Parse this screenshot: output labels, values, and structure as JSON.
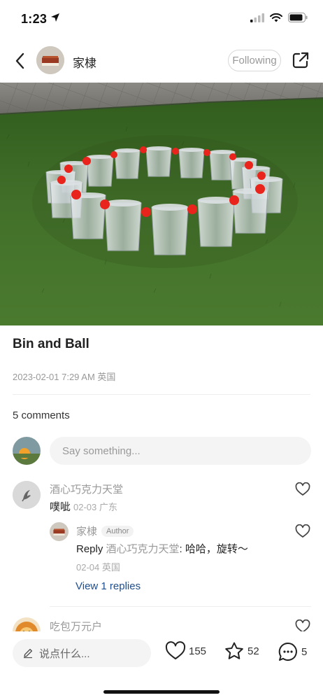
{
  "status_bar": {
    "time": "1:23"
  },
  "nav": {
    "name": "家棣",
    "follow_label": "Following"
  },
  "post": {
    "title": "Bin and Ball",
    "meta": "2023-02-01 7:29 AM 英国"
  },
  "comments_section": {
    "count_label": "5 comments",
    "input_placeholder": "Say something..."
  },
  "comments": [
    {
      "name": "酒心巧克力天堂",
      "text": "噗呲",
      "date": "02-03 广东"
    },
    {
      "name": "家棣",
      "badge": "Author",
      "reply_prefix": "Reply",
      "reply_to": "酒心巧克力天堂",
      "text": ": 哈哈，旋转～",
      "date": "02-04 英国"
    },
    {
      "name": "吃包万元户"
    }
  ],
  "view_replies": "View 1 replies",
  "bottom_bar": {
    "input_placeholder": "说点什么...",
    "likes": "155",
    "favorites": "52",
    "comments": "5"
  },
  "colors": {
    "link_blue": "#1f4e8c",
    "muted_text": "#999999",
    "grass_green": "#3f6b26",
    "ball_red": "#e8241c"
  },
  "icons": [
    "location-arrow-icon",
    "signal-icon",
    "wifi-icon",
    "battery-icon",
    "back-chevron-icon",
    "share-icon",
    "heart-icon",
    "star-icon",
    "comment-bubble-icon",
    "pencil-icon"
  ]
}
